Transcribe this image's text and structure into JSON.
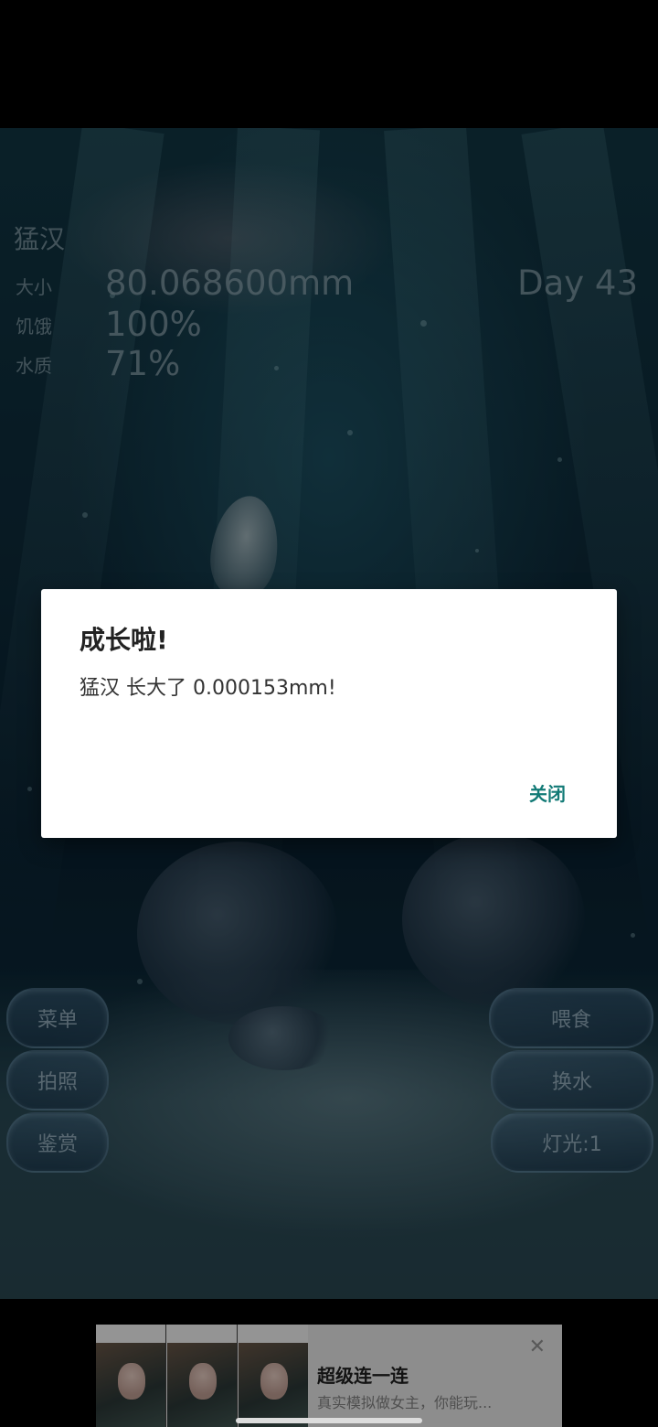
{
  "pet": {
    "name": "猛汉",
    "day": "Day 43",
    "stats": [
      {
        "label": "大小",
        "value": "80.068600mm"
      },
      {
        "label": "饥饿",
        "value": "100%"
      },
      {
        "label": "水质",
        "value": "71%"
      }
    ]
  },
  "buttons": {
    "menu": "菜单",
    "photo": "拍照",
    "appreciate": "鉴赏",
    "feed": "喂食",
    "change_water": "换水",
    "light": "灯光:1"
  },
  "dialog": {
    "title": "成长啦!",
    "message": "猛汉 长大了 0.000153mm!",
    "close_label": "关闭"
  },
  "ad": {
    "title": "超级连一连",
    "subtitle": "真实模拟做女主，你能玩...",
    "close_icon": "close-icon"
  },
  "colors": {
    "accent": "#127a76",
    "scene_top": "#123846",
    "scene_bottom": "#1b3f4f"
  }
}
